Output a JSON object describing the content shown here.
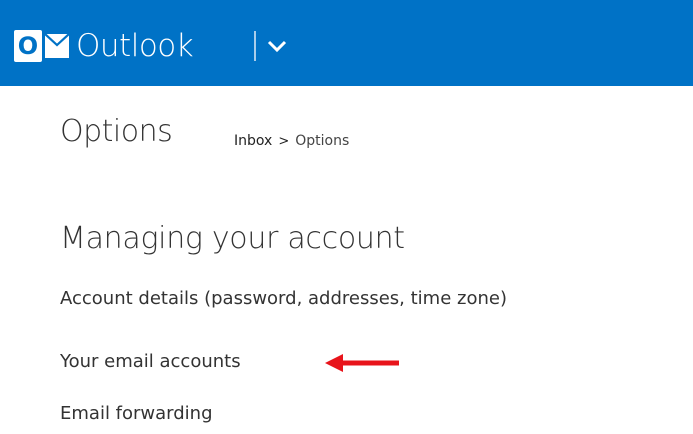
{
  "header": {
    "logo_letter": "O",
    "app_name": "Outlook",
    "brand_color": "#0072c6",
    "logo_icon": "outlook-logo-icon",
    "switcher_icon": "chevron-down-icon"
  },
  "page": {
    "title": "Options",
    "breadcrumb": {
      "root": "Inbox",
      "separator": ">",
      "current": "Options"
    }
  },
  "section": {
    "heading": "Managing your account",
    "links": [
      {
        "label": "Account details (password, addresses, time zone)"
      },
      {
        "label": "Your email accounts"
      },
      {
        "label": "Email forwarding"
      }
    ]
  },
  "annotation": {
    "arrow_icon": "arrow-left-icon",
    "arrow_color": "#e8141b"
  }
}
